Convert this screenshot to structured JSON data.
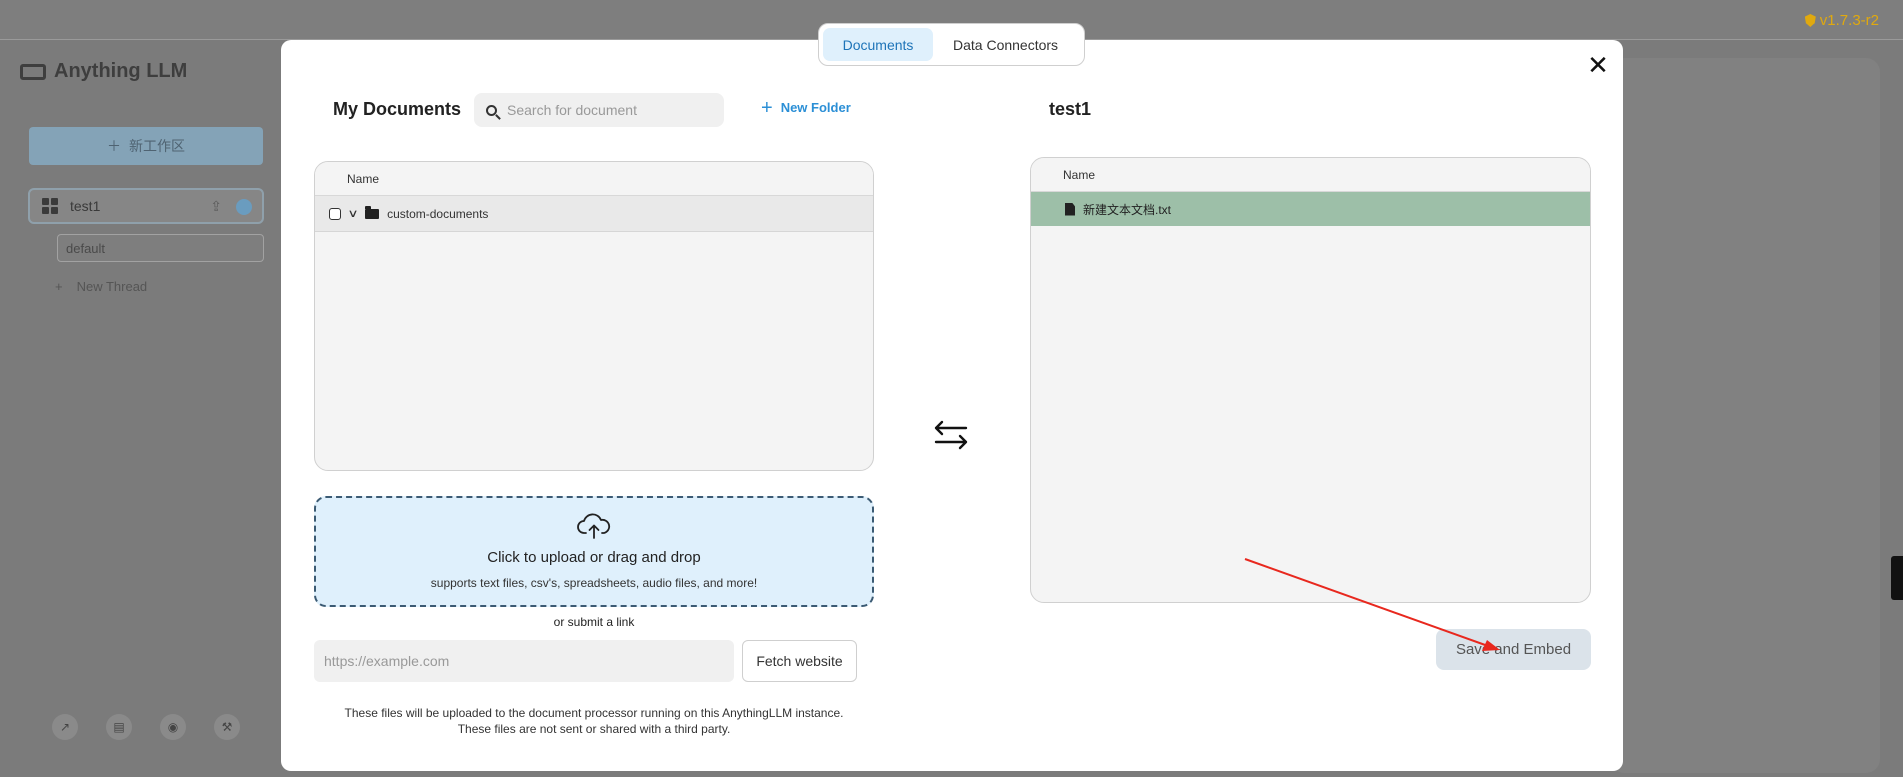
{
  "app": {
    "version": "v1.7.3-r2",
    "logo_text": "Anything LLM"
  },
  "sidebar": {
    "new_workspace_label": "新工作区",
    "workspace_name": "test1",
    "thread_name": "default",
    "new_thread_label": "New Thread"
  },
  "modal": {
    "tabs": [
      {
        "label": "Documents",
        "active": true
      },
      {
        "label": "Data Connectors",
        "active": false
      }
    ],
    "my_documents": {
      "title": "My Documents",
      "search_placeholder": "Search for document",
      "new_folder_label": "New Folder",
      "column_name": "Name",
      "folders": [
        "custom-documents"
      ]
    },
    "upload": {
      "title": "Click to upload or drag and drop",
      "subtitle": "supports text files, csv's, spreadsheets, audio files, and more!",
      "or_link_text": "or submit a link",
      "url_placeholder": "https://example.com",
      "fetch_label": "Fetch website",
      "disclaimer_line1": "These files will be uploaded to the document processor running on this AnythingLLM instance.",
      "disclaimer_line2": "These files are not sent or shared with a third party."
    },
    "workspace": {
      "title": "test1",
      "column_name": "Name",
      "files": [
        "新建文本文档.txt"
      ],
      "save_label": "Save and Embed"
    }
  },
  "colors": {
    "accent": "#2b8fd6",
    "active_tab_bg": "#dff0fc",
    "selected_file_row": "#9dbfa8",
    "annotation_arrow": "#e8281e",
    "version": "#e0a90f"
  },
  "icons": {
    "close": "close-icon",
    "search": "search-icon",
    "plus": "plus-icon",
    "folder": "folder-icon",
    "file": "file-icon",
    "upload": "cloud-upload-icon",
    "swap": "swap-arrows-icon"
  }
}
